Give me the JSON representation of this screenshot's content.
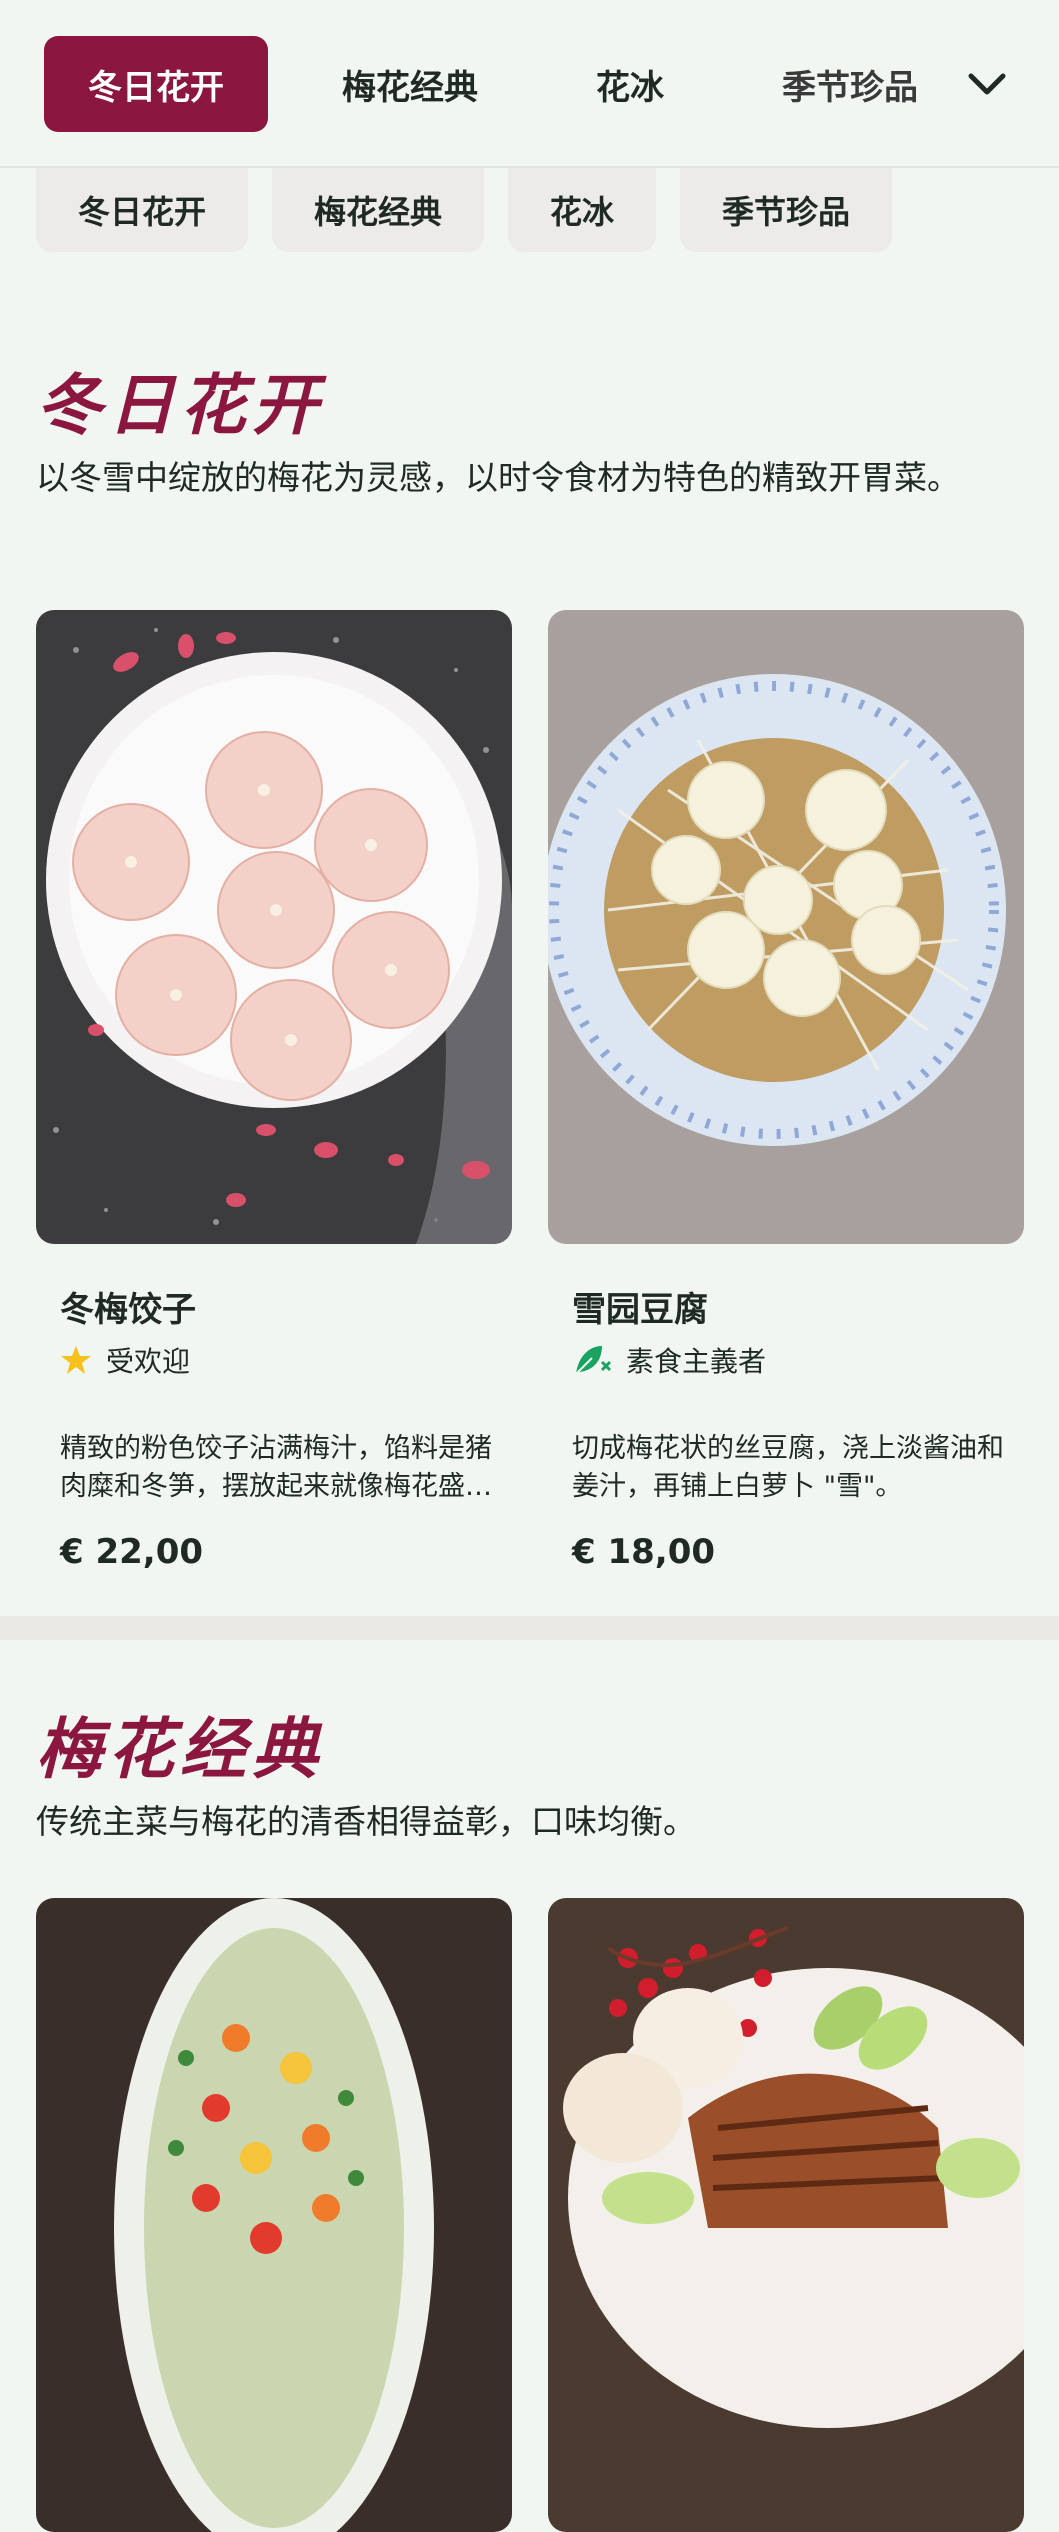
{
  "tabs": [
    {
      "label": "冬日花开",
      "active": true
    },
    {
      "label": "梅花经典",
      "active": false
    },
    {
      "label": "花冰",
      "active": false
    },
    {
      "label": "季节珍品",
      "active": false
    }
  ],
  "pills": [
    "冬日花开",
    "梅花经典",
    "花冰",
    "季节珍品"
  ],
  "sections": [
    {
      "title": "冬日花开",
      "description": "以冬雪中绽放的梅花为灵感，以时令食材为特色的精致开胃菜。",
      "items": [
        {
          "name": "冬梅饺子",
          "tag": "受欢迎",
          "tag_icon": "star-icon",
          "description": "精致的粉色饺子沾满梅汁，馅料是猪肉糜和冬笋，摆放起来就像梅花盛开。",
          "price": "€ 22,00"
        },
        {
          "name": "雪园豆腐",
          "tag": "素食主義者",
          "tag_icon": "vegan-leaf-icon",
          "description": "切成梅花状的丝豆腐，浇上淡酱油和姜汁，再铺上白萝卜 \"雪\"。",
          "price": "€ 18,00"
        }
      ]
    },
    {
      "title": "梅花经典",
      "description": "传统主菜与梅花的清香相得益彰，口味均衡。"
    }
  ],
  "colors": {
    "accent": "#8b1740",
    "background": "#f2f6f2",
    "star": "#f4c21a",
    "vegan": "#1aa360"
  }
}
